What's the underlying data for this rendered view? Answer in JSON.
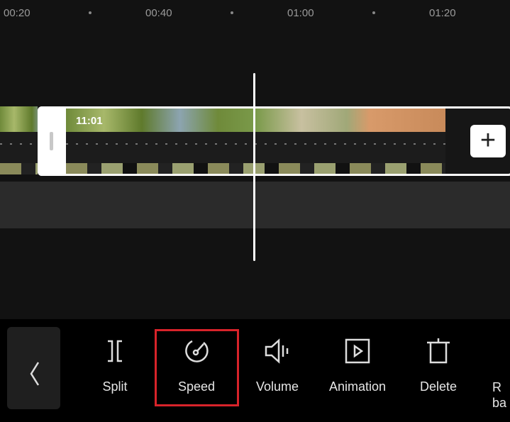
{
  "ruler": {
    "ticks": [
      "00:20",
      "00:40",
      "01:00",
      "01:20"
    ]
  },
  "timeline": {
    "clip_duration": "11:01",
    "add_button": "+"
  },
  "toolbar": {
    "back_icon": "chevron-left-icon",
    "items": [
      {
        "label": "Split",
        "icon": "split-icon"
      },
      {
        "label": "Speed",
        "icon": "speed-icon",
        "selected": true
      },
      {
        "label": "Volume",
        "icon": "volume-icon"
      },
      {
        "label": "Animation",
        "icon": "animation-icon"
      },
      {
        "label": "Delete",
        "icon": "delete-icon"
      },
      {
        "label": "R\nba",
        "icon": ""
      }
    ]
  },
  "colors": {
    "highlight": "#d8232a",
    "background": "#121212"
  }
}
